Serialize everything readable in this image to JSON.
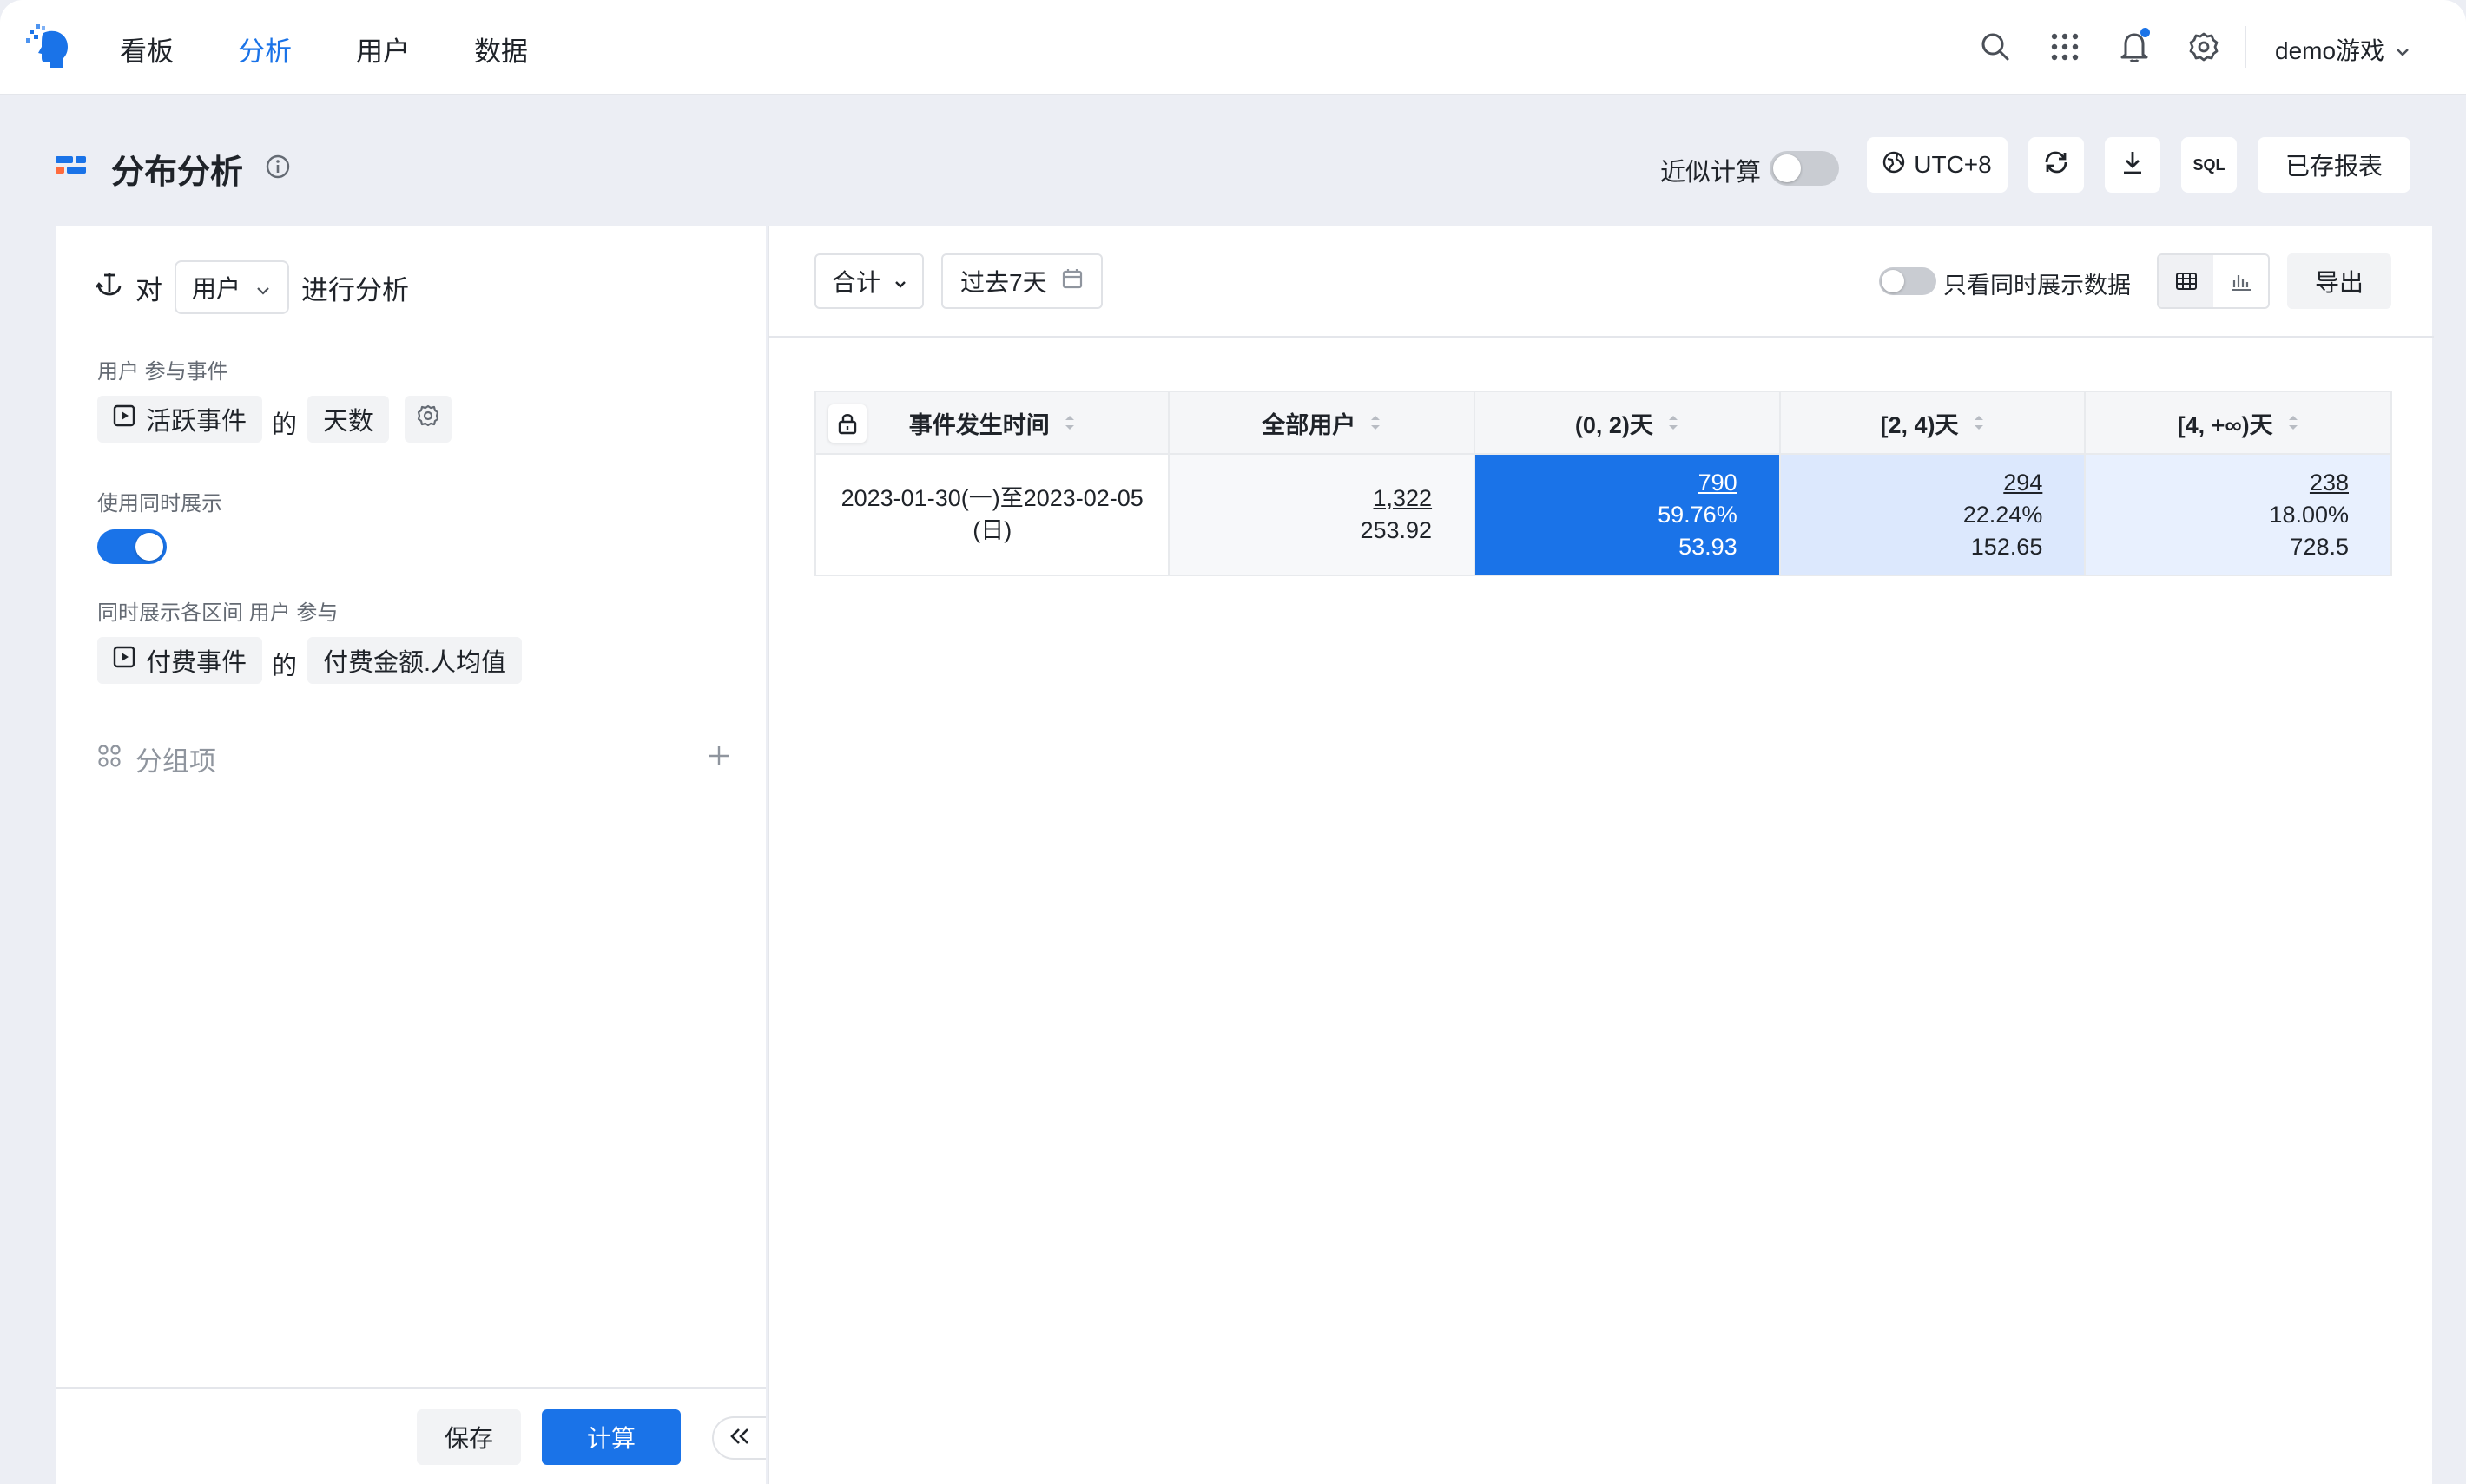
{
  "nav": {
    "items": [
      {
        "label": "看板",
        "active": false
      },
      {
        "label": "分析",
        "active": true
      },
      {
        "label": "用户",
        "active": false
      },
      {
        "label": "数据",
        "active": false
      }
    ],
    "username": "demo游戏",
    "accent_color": "#1a73e8"
  },
  "header": {
    "title": "分布分析",
    "approx_label": "近似计算",
    "approx_enabled": false,
    "timezone": "UTC+8",
    "sql_label": "SQL",
    "saved_reports": "已存报表"
  },
  "left": {
    "prefix": "对",
    "entity": "用户",
    "suffix": "进行分析",
    "event_caption": "用户 参与事件",
    "event": "活跃事件",
    "de": "的",
    "metric": "天数",
    "concurrent_caption": "使用同时展示",
    "concurrent_enabled": true,
    "interval_caption": "同时展示各区间 用户 参与",
    "pay_event": "付费事件",
    "pay_metric": "付费金额.人均值",
    "group_label": "分组项",
    "save": "保存",
    "calc": "计算"
  },
  "right": {
    "aggregate": "合计",
    "date_range": "过去7天",
    "only_label": "只看同时展示数据",
    "only_enabled": false,
    "export": "导出"
  },
  "table": {
    "headers": [
      "事件发生时间",
      "全部用户",
      "(0, 2)天",
      "[2, 4)天",
      "[4, +∞)天"
    ],
    "row": {
      "time_line1": "2023-01-30(一)至2023-02-05",
      "time_line2": "(日)",
      "total": {
        "count": "1,322",
        "value": "253.92"
      },
      "b1": {
        "count": "790",
        "pct": "59.76%",
        "value": "53.93"
      },
      "b2": {
        "count": "294",
        "pct": "22.24%",
        "value": "152.65"
      },
      "b3": {
        "count": "238",
        "pct": "18.00%",
        "value": "728.5"
      }
    }
  },
  "icons": [
    "logo-icon",
    "search-icon",
    "apps-grid-icon",
    "bell-icon",
    "gear-icon",
    "chevron-down-icon",
    "distribution-icon",
    "info-icon",
    "globe-icon",
    "refresh-icon",
    "download-icon",
    "sql-icon",
    "anchor-icon",
    "event-icon",
    "settings-icon",
    "group-icon",
    "plus-icon",
    "calendar-icon",
    "table-view-icon",
    "chart-view-icon",
    "lock-icon",
    "sort-icon",
    "collapse-icon"
  ]
}
